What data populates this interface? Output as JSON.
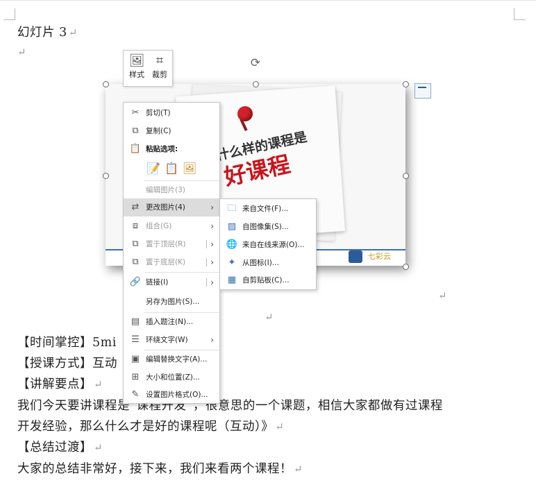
{
  "doc": {
    "slide_title": "幻灯片 3",
    "lines": [
      "【时间掌控】5mi",
      "【授课方式】互动",
      "【讲解要点】",
      "我们今天要讲课程是“课程开发”，很意思的一个课题，相信大家都做有过课程",
      "开发经验，那么什么才是好的课程呢（互动）》",
      "【总结过渡】",
      "大家的总结非常好，接下来，我们来看两个课程！"
    ],
    "para_mark": "↵"
  },
  "image": {
    "slogan_line1": "什么样的课程是",
    "slogan_line2": "好课程",
    "logo_text": "七彩云"
  },
  "mini_toolbar": {
    "style_label": "样式",
    "crop_label": "裁剪"
  },
  "context_menu": {
    "items": [
      {
        "label": "剪切(T)",
        "icon": "scissors-icon"
      },
      {
        "label": "复制(C)",
        "icon": "copy-icon"
      },
      {
        "label": "粘贴选项:",
        "icon": "clipboard-icon"
      },
      {
        "label": "编辑图片(3)",
        "icon": ""
      },
      {
        "label": "更改图片(4)",
        "icon": "change-picture-icon"
      },
      {
        "label": "组合(G)",
        "icon": "group-icon"
      },
      {
        "label": "置于顶层(R)",
        "icon": "bring-front-icon"
      },
      {
        "label": "置于底层(K)",
        "icon": "send-back-icon"
      },
      {
        "label": "链接(I)",
        "icon": "link-icon"
      },
      {
        "label": "另存为图片(S)...",
        "icon": ""
      },
      {
        "label": "插入题注(N)...",
        "icon": "caption-icon"
      },
      {
        "label": "环绕文字(W)",
        "icon": "wrap-text-icon"
      },
      {
        "label": "编辑替换文字(A)...",
        "icon": "alt-text-icon"
      },
      {
        "label": "大小和位置(Z)...",
        "icon": "size-position-icon"
      },
      {
        "label": "设置图片格式(O)...",
        "icon": "format-picture-icon"
      }
    ]
  },
  "submenu": {
    "items": [
      {
        "label": "来自文件(F)...",
        "icon": "from-file-icon"
      },
      {
        "label": "自图像集(S)...",
        "icon": "image-set-icon"
      },
      {
        "label": "来自在线来源(O)...",
        "icon": "online-source-icon"
      },
      {
        "label": "从图标(I)...",
        "icon": "from-icons-icon"
      },
      {
        "label": "自剪贴板(C)...",
        "icon": "from-clipboard-icon"
      }
    ]
  }
}
